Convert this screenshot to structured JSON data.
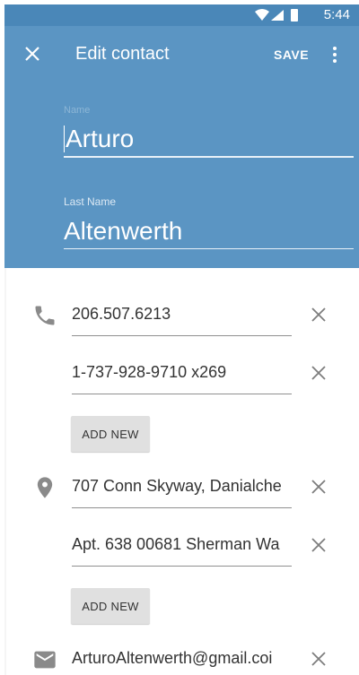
{
  "status_bar": {
    "time": "5:44"
  },
  "header": {
    "title": "Edit contact",
    "save_label": "SAVE"
  },
  "fields": {
    "first_name": {
      "label": "Name",
      "value": "Arturo"
    },
    "last_name": {
      "label": "Last Name",
      "value": "Altenwerth"
    }
  },
  "phones": [
    "206.507.6213",
    "1-737-928-9710 x269"
  ],
  "addresses": [
    "707 Conn Skyway, Danialche",
    "Apt. 638 00681 Sherman Wa"
  ],
  "emails": [
    "ArturoAltenwerth@gmail.coi"
  ],
  "buttons": {
    "add_new_phone": "ADD NEW",
    "add_new_address": "ADD NEW"
  },
  "colors": {
    "header": "#5b95c3",
    "status_bar": "#4a87b8"
  },
  "icons": [
    "wifi-icon",
    "signal-icon",
    "battery-icon",
    "close-icon",
    "more-vert-icon",
    "phone-icon",
    "location-icon",
    "email-icon",
    "clear-icon"
  ]
}
